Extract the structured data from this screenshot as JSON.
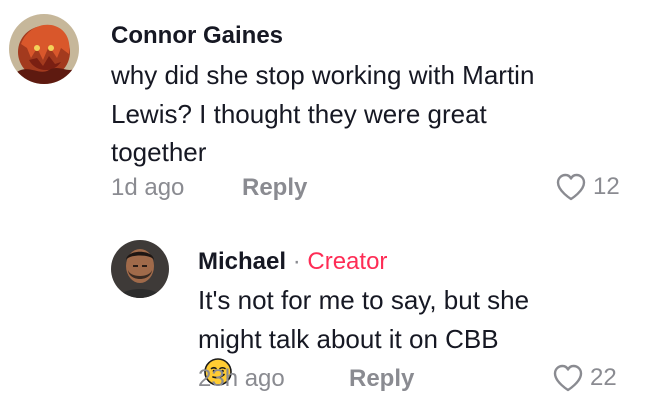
{
  "comments": [
    {
      "author": "Connor Gaines",
      "text_lines": [
        "why did she stop working with Martin",
        "Lewis? I thought they were great",
        "together"
      ],
      "time": "1d ago",
      "reply_label": "Reply",
      "likes": "12",
      "avatar_icon": "anime-character-avatar"
    }
  ],
  "reply": {
    "author": "Michael",
    "separator": "·",
    "badge": "Creator",
    "text_lines": [
      "It's not for me to say, but she",
      "might talk about it on CBB"
    ],
    "emoji": "smirking-face",
    "time": "23h ago",
    "reply_label": "Reply",
    "likes": "22",
    "avatar_icon": "man-portrait-avatar"
  },
  "colors": {
    "text": "#161823",
    "muted": "#8a8b91",
    "creator": "#fe2c55"
  }
}
